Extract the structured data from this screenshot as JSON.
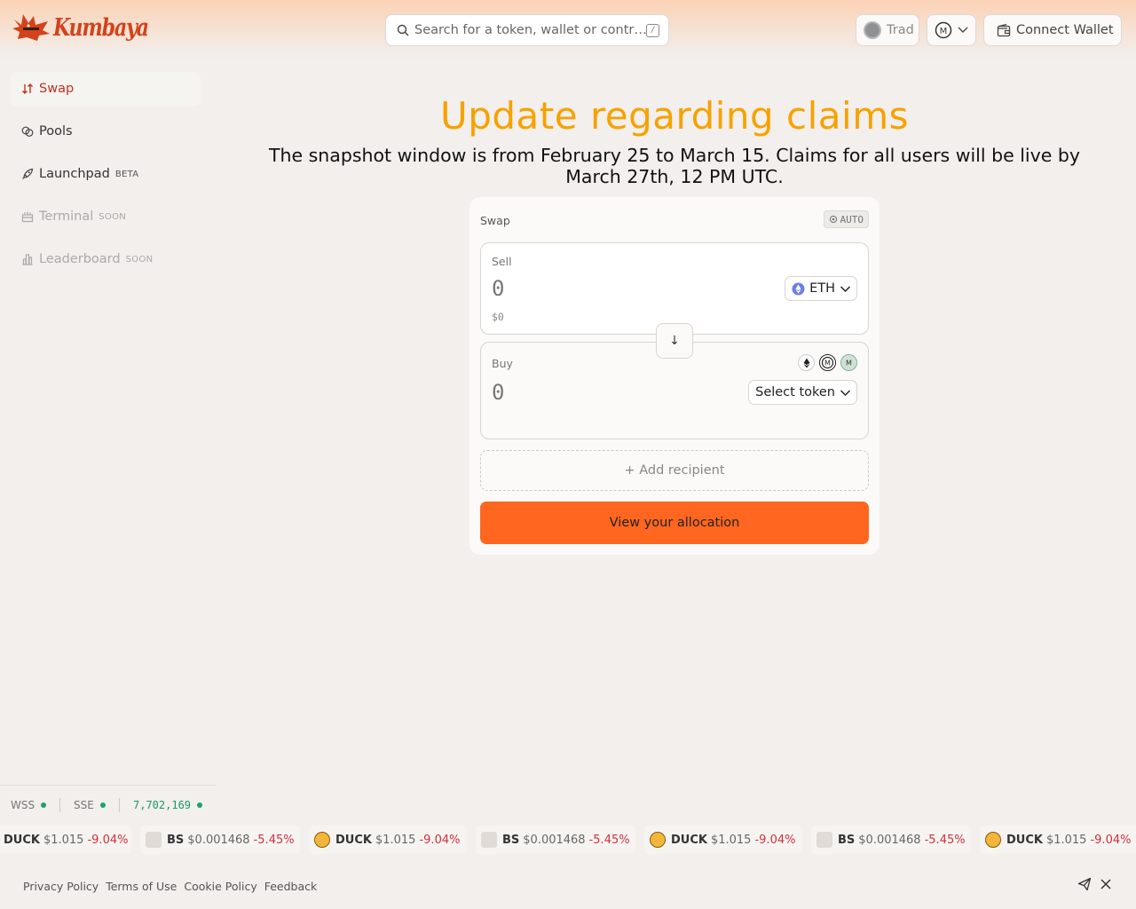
{
  "header": {
    "logo_text": "Kumbaya",
    "search_placeholder": "Search for a token, wallet or contr…",
    "search_shortcut": "/",
    "trad_label": "Trad",
    "connect_wallet_label": "Connect Wallet"
  },
  "sidebar": {
    "items": [
      {
        "label": "Swap",
        "badge": "",
        "icon": "swap-arrows-icon",
        "active": true
      },
      {
        "label": "Pools",
        "badge": "",
        "icon": "pools-icon",
        "active": false
      },
      {
        "label": "Launchpad",
        "badge": "BETA",
        "icon": "rocket-icon",
        "active": false
      },
      {
        "label": "Terminal",
        "badge": "SOON",
        "icon": "terminal-icon",
        "active": false
      },
      {
        "label": "Leaderboard",
        "badge": "SOON",
        "icon": "bar-chart-icon",
        "active": false
      }
    ]
  },
  "announcement": {
    "title": "Update regarding claims",
    "body": "The snapshot window is from February 25 to March 15. Claims for all users will be live by March 27th, 12 PM UTC."
  },
  "swap": {
    "title": "Swap",
    "auto_label": "AUTO",
    "sell": {
      "label": "Sell",
      "amount": "0",
      "usd": "$0",
      "token": "ETH"
    },
    "buy": {
      "label": "Buy",
      "amount": "0",
      "token_button": "Select token"
    },
    "add_recipient_label": "+ Add recipient",
    "cta_label": "View your allocation"
  },
  "status": {
    "wss": "WSS",
    "sse": "SSE",
    "block": "7,702,169"
  },
  "ticker": [
    {
      "symbol": "DUCK",
      "price": "$1.015",
      "change": "-9.04%",
      "icon": "duck"
    },
    {
      "symbol": "BS",
      "price": "$0.001468",
      "change": "-5.45%",
      "icon": "bs"
    },
    {
      "symbol": "DUCK",
      "price": "$1.015",
      "change": "-9.04%",
      "icon": "duck"
    },
    {
      "symbol": "BS",
      "price": "$0.001468",
      "change": "-5.45%",
      "icon": "bs"
    },
    {
      "symbol": "DUCK",
      "price": "$1.015",
      "change": "-9.04%",
      "icon": "duck"
    },
    {
      "symbol": "BS",
      "price": "$0.001468",
      "change": "-5.45%",
      "icon": "bs"
    },
    {
      "symbol": "DUCK",
      "price": "$1.015",
      "change": "-9.04%",
      "icon": "duck"
    }
  ],
  "footer": {
    "links": [
      "Privacy Policy",
      "Terms of Use",
      "Cookie Policy",
      "Feedback"
    ]
  },
  "colors": {
    "accent": "#ff6620",
    "brand": "#d4421b",
    "title": "#f6a200",
    "negative": "#d1303c",
    "online": "#1aa36a"
  }
}
